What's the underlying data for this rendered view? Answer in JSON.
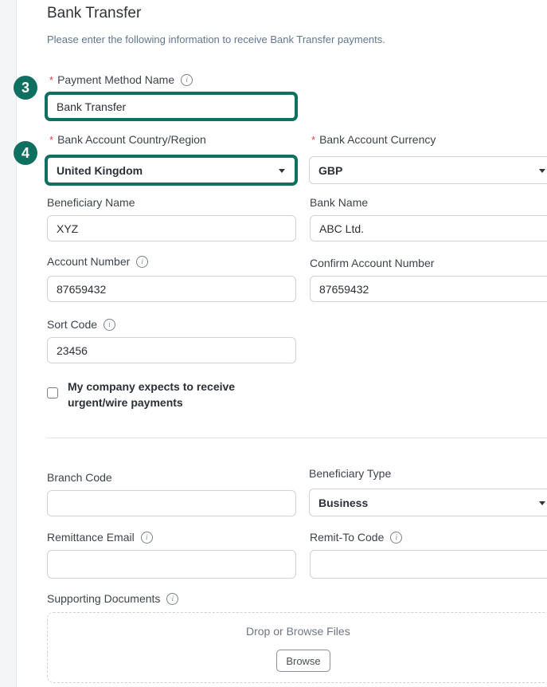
{
  "header": {
    "title": "Bank Transfer",
    "subtitle": "Please enter the following information to receive Bank Transfer payments."
  },
  "steps": {
    "three": "3",
    "four": "4"
  },
  "fields": {
    "payment_method_name": {
      "label": "Payment Method Name",
      "value": "Bank Transfer",
      "required": true
    },
    "bank_account_country": {
      "label": "Bank Account Country/Region",
      "value": "United Kingdom",
      "required": true
    },
    "bank_account_currency": {
      "label": "Bank Account Currency",
      "value": "GBP",
      "required": true
    },
    "beneficiary_name": {
      "label": "Beneficiary Name",
      "value": "XYZ"
    },
    "bank_name": {
      "label": "Bank Name",
      "value": "ABC Ltd."
    },
    "account_number": {
      "label": "Account Number",
      "value": "87659432"
    },
    "confirm_account_number": {
      "label": "Confirm Account Number",
      "value": "87659432"
    },
    "sort_code": {
      "label": "Sort Code",
      "value": "23456"
    },
    "branch_code": {
      "label": "Branch Code",
      "value": ""
    },
    "beneficiary_type": {
      "label": "Beneficiary Type",
      "value": "Business"
    },
    "remittance_email": {
      "label": "Remittance Email",
      "value": ""
    },
    "remit_to_code": {
      "label": "Remit-To Code",
      "value": ""
    }
  },
  "urgent_checkbox": {
    "label": "My company expects to receive urgent/wire payments",
    "checked": false
  },
  "supporting_documents": {
    "label": "Supporting Documents",
    "drop_text": "Drop or Browse Files",
    "browse_label": "Browse"
  },
  "colors": {
    "highlight": "#0e7060",
    "required": "#e0434c"
  },
  "icons": {
    "info": "info-icon",
    "dropdown": "caret-down-icon"
  }
}
